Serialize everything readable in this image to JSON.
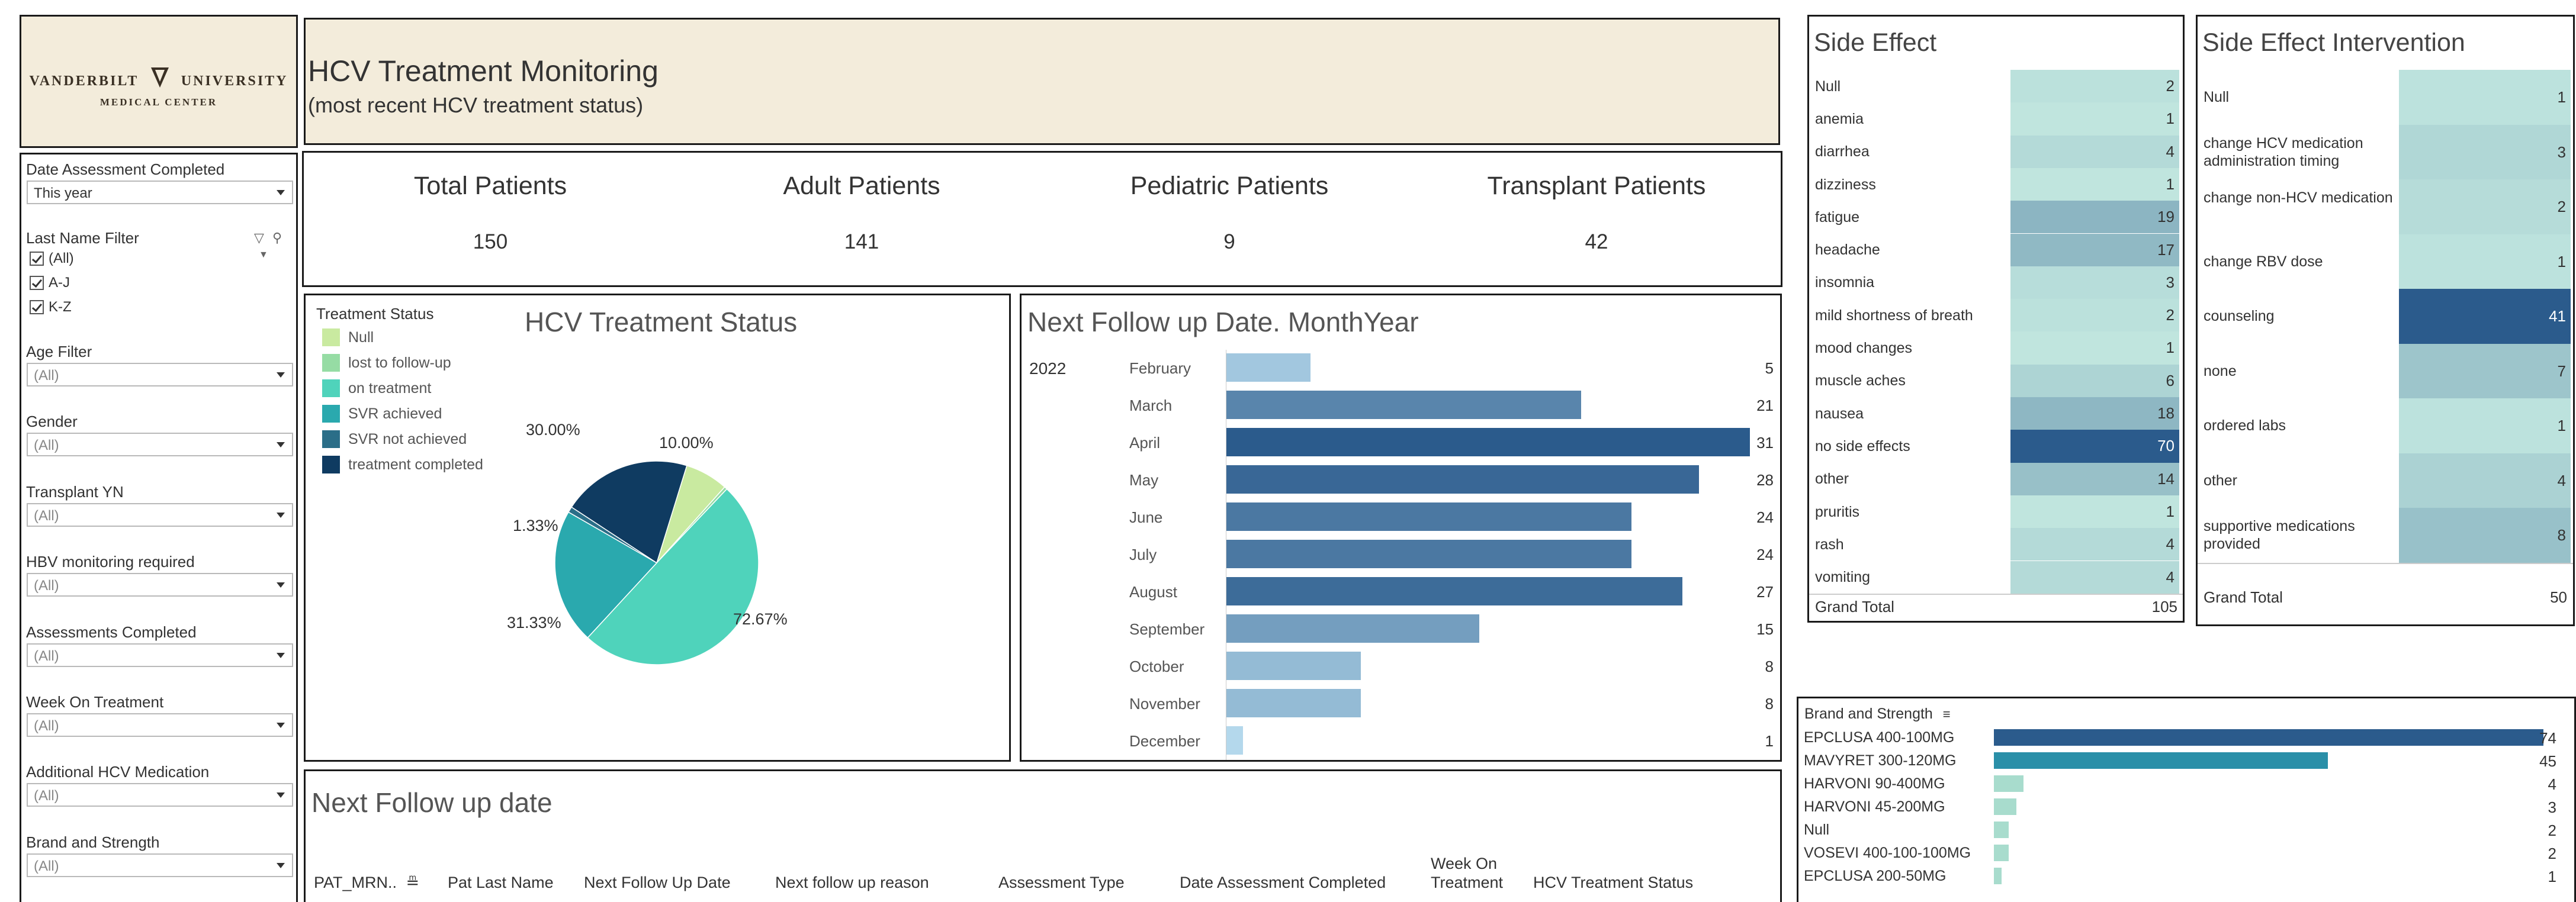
{
  "header": {
    "logo_line1_left": "VANDERBILT",
    "logo_line1_right": "UNIVERSITY",
    "logo_line2": "MEDICAL CENTER",
    "title": "HCV Treatment Monitoring",
    "subtitle": "(most recent HCV treatment status)"
  },
  "filters": {
    "date_assessment": {
      "label": "Date Assessment Completed",
      "value": "This year"
    },
    "last_name": {
      "label": "Last Name Filter",
      "options": [
        "(All)",
        "A-J",
        "K-Z"
      ]
    },
    "age": {
      "label": "Age Filter",
      "value": "(All)"
    },
    "gender": {
      "label": "Gender",
      "value": "(All)"
    },
    "transplant": {
      "label": "Transplant YN",
      "value": "(All)"
    },
    "hbv": {
      "label": "HBV monitoring required",
      "value": "(All)"
    },
    "assessments": {
      "label": "Assessments Completed",
      "value": "(All)"
    },
    "week": {
      "label": "Week On Treatment",
      "value": "(All)"
    },
    "additional": {
      "label": "Additional HCV Medication",
      "value": "(All)"
    },
    "brand": {
      "label": "Brand and Strength",
      "value": "(All)"
    }
  },
  "kpis": [
    {
      "label": "Total Patients",
      "value": "150"
    },
    {
      "label": "Adult Patients",
      "value": "141"
    },
    {
      "label": "Pediatric Patients",
      "value": "9"
    },
    {
      "label": "Transplant Patients",
      "value": "42"
    }
  ],
  "chart_data": [
    {
      "type": "pie",
      "title": "HCV Treatment Status",
      "legend_title": "Treatment Status",
      "legend_placement": "left",
      "slices": [
        {
          "label": "Null",
          "percent": 10.0,
          "color": "#c9eaa0",
          "display": "10.00%"
        },
        {
          "label": "lost to follow-up",
          "percent": 0.67,
          "color": "#96dca4",
          "display": ""
        },
        {
          "label": "on treatment",
          "percent": 72.67,
          "color": "#4fd3bb",
          "display": "72.67%"
        },
        {
          "label": "SVR achieved",
          "percent": 31.33,
          "color": "#2aa9ae",
          "display": "31.33%"
        },
        {
          "label": "SVR not achieved",
          "percent": 1.33,
          "color": "#2b6e88",
          "display": "1.33%"
        },
        {
          "label": "treatment completed",
          "percent": 30.0,
          "color": "#0f3b61",
          "display": "30.00%"
        }
      ]
    },
    {
      "type": "bar",
      "title": "Next Follow up Date. MonthYear",
      "year": "2022",
      "categories": [
        "February",
        "March",
        "April",
        "May",
        "June",
        "July",
        "August",
        "September",
        "October",
        "November",
        "December"
      ],
      "values": [
        5,
        21,
        31,
        28,
        24,
        24,
        27,
        15,
        8,
        8,
        1
      ],
      "xlim": [
        0,
        31
      ]
    },
    {
      "type": "bar",
      "title": "",
      "header": "Brand and Strength",
      "categories": [
        "EPCLUSA 400-100MG",
        "MAVYRET 300-120MG",
        "HARVONI 90-400MG",
        "HARVONI 45-200MG",
        "Null",
        "VOSEVI 400-100-100MG",
        "EPCLUSA 200-50MG"
      ],
      "values": [
        74,
        45,
        4,
        3,
        2,
        2,
        1
      ],
      "xlim": [
        0,
        74
      ]
    },
    {
      "type": "heatmap",
      "title": "Side Effect",
      "categories": [
        "Null",
        "anemia",
        "diarrhea",
        "dizziness",
        "fatigue",
        "headache",
        "insomnia",
        "mild shortness of breath",
        "mood changes",
        "muscle aches",
        "nausea",
        "no side effects",
        "other",
        "pruritis",
        "rash",
        "vomiting"
      ],
      "values": [
        2,
        1,
        4,
        1,
        19,
        17,
        3,
        2,
        1,
        6,
        18,
        70,
        14,
        1,
        4,
        4
      ],
      "grand_total_label": "Grand Total",
      "grand_total": 105
    },
    {
      "type": "heatmap",
      "title": "Side Effect Intervention",
      "categories": [
        "Null",
        "change HCV medication administration timing",
        "change non-HCV medication",
        "change RBV dose",
        "counseling",
        "none",
        "ordered labs",
        "other",
        "supportive medications provided"
      ],
      "values": [
        1,
        3,
        2,
        1,
        41,
        7,
        1,
        4,
        8
      ],
      "grand_total_label": "Grand Total",
      "grand_total": 50
    }
  ],
  "table": {
    "title": "Next Follow up date",
    "columns": [
      "PAT_MRN..",
      "Pat Last Name",
      "Next Follow Up Date",
      "Next follow up reason",
      "Assessment Type",
      "Date Assessment Completed",
      "Week On Treatment",
      "HCV Treatment Status"
    ]
  },
  "colors": {
    "header_bg": "#f3ecdb",
    "bar_scale_low": "#b9dcef",
    "bar_scale_high": "#2b5b8c",
    "heat_low": "#c6ebe2",
    "heat_high": "#2b5b8c"
  }
}
